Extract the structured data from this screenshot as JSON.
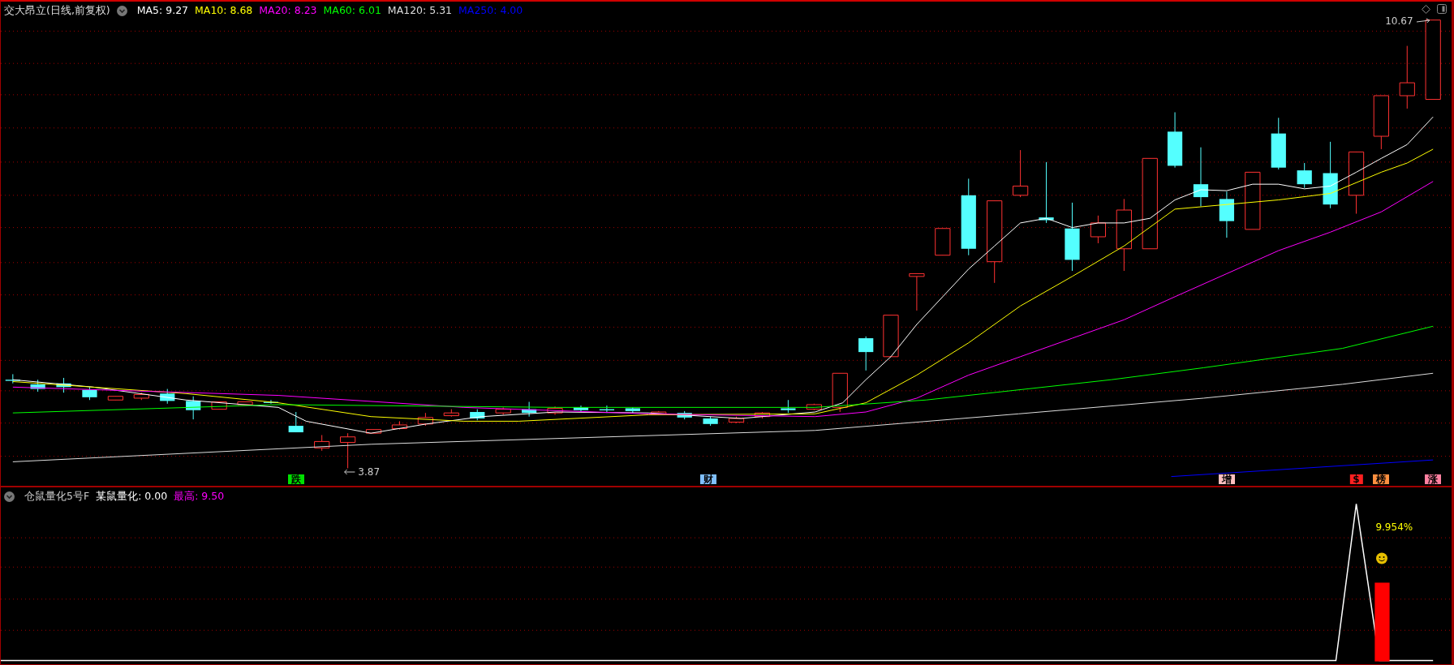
{
  "header": {
    "title": "交大昂立(日线,前复权)",
    "moving_averages": [
      {
        "label": "MA5: 9.27",
        "color": "#ffffff"
      },
      {
        "label": "MA10: 8.68",
        "color": "#ffff00"
      },
      {
        "label": "MA20: 8.23",
        "color": "#ff00ff"
      },
      {
        "label": "MA60: 6.01",
        "color": "#00ff00"
      },
      {
        "label": "MA120: 5.31",
        "color": "#dddddd"
      },
      {
        "label": "MA250: 4.00",
        "color": "#0000ff"
      }
    ]
  },
  "price_labels": {
    "high": "10.67",
    "low": "3.87"
  },
  "signal_markers": [
    {
      "label": "跌",
      "color": "#00e000"
    },
    {
      "label": "财",
      "color": "#80c0ff"
    },
    {
      "label": "增",
      "color": "#ffc0c0"
    },
    {
      "label": "$",
      "color": "#ff2020"
    },
    {
      "label": "榜",
      "color": "#ff9040"
    },
    {
      "label": "涨",
      "color": "#ff80a0"
    }
  ],
  "indicator": {
    "title": "仓鼠量化5号F",
    "readings": [
      {
        "label": "某鼠量化: 0.00",
        "color": "#ffffff"
      },
      {
        "label": "最高: 9.50",
        "color": "#ff00ff"
      }
    ],
    "annotation": "9.954%"
  }
}
